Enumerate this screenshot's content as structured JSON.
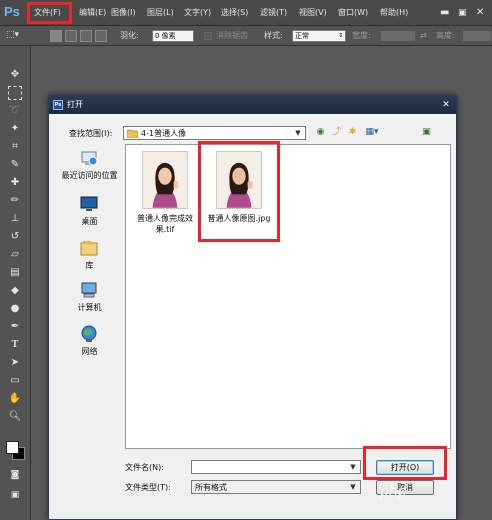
{
  "app": {
    "logo": "Ps"
  },
  "menubar": {
    "items": [
      "文件(F)",
      "编辑(E)",
      "图像(I)",
      "图层(L)",
      "文字(Y)",
      "选择(S)",
      "滤镜(T)",
      "视图(V)",
      "窗口(W)",
      "帮助(H)"
    ]
  },
  "options": {
    "feather_label": "羽化:",
    "feather_value": "0 像素",
    "antialias_label": "消除锯齿",
    "style_label": "样式:",
    "style_value": "正常",
    "width_label": "宽度:",
    "height_label": "高度:"
  },
  "dialog": {
    "title": "打开",
    "look_in_label": "查找范围(I):",
    "look_in_value": "4-1普通人像",
    "places": [
      {
        "label": "最近访问的位置",
        "icon": "recent-places-icon"
      },
      {
        "label": "桌面",
        "icon": "desktop-icon"
      },
      {
        "label": "库",
        "icon": "libraries-icon"
      },
      {
        "label": "计算机",
        "icon": "computer-icon"
      },
      {
        "label": "网络",
        "icon": "network-icon"
      }
    ],
    "files": [
      {
        "name": "普通人像完成效果.tif",
        "selected": false
      },
      {
        "name": "普通人像原图.jpg",
        "selected": true
      }
    ],
    "filename_label": "文件名(N):",
    "filename_value": "",
    "filetype_label": "文件类型(T):",
    "filetype_value": "所有格式",
    "open_button": "打开(O)",
    "cancel_button": "取消"
  },
  "watermark": "php",
  "colors": {
    "highlight": "#e8272d",
    "foreground": "#ffffff",
    "background": "#000000"
  }
}
